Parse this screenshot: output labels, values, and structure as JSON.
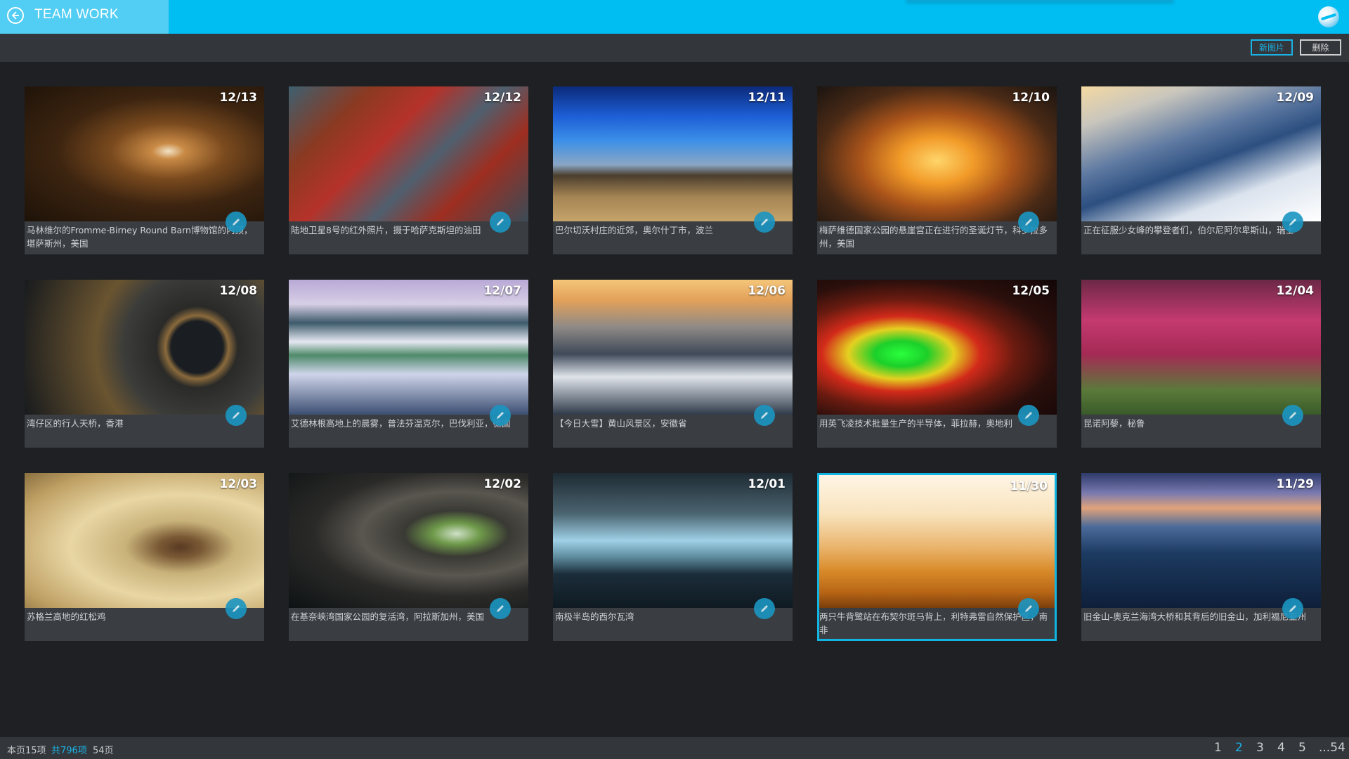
{
  "app": {
    "title": "TEAM WORK",
    "logo_icon": "globe-logo-icon",
    "back_icon": "back-arrow-icon"
  },
  "toolbar": {
    "new_label": "新图片",
    "delete_label": "删除"
  },
  "gallery": [
    {
      "date": "12/13",
      "caption": "马林维尔的Fromme-Birney Round Barn博物馆的内顶，堪萨斯州，美国",
      "selected": false
    },
    {
      "date": "12/12",
      "caption": "陆地卫星8号的红外照片，摄于哈萨克斯坦的油田",
      "selected": false
    },
    {
      "date": "12/11",
      "caption": "巴尔切沃村庄的近郊，奥尔什丁市，波兰",
      "selected": false
    },
    {
      "date": "12/10",
      "caption": "梅萨维德国家公园的悬崖宫正在进行的圣诞灯节，科罗拉多州，美国",
      "selected": false
    },
    {
      "date": "12/09",
      "caption": "正在征服少女峰的攀登者们，伯尔尼阿尔卑斯山，瑞士",
      "selected": false
    },
    {
      "date": "12/08",
      "caption": "湾仔区的行人天桥，香港",
      "selected": false
    },
    {
      "date": "12/07",
      "caption": "艾德林根高地上的晨雾，普法芬温克尔，巴伐利亚，德国",
      "selected": false
    },
    {
      "date": "12/06",
      "caption": "【今日大雪】黄山风景区，安徽省",
      "selected": false
    },
    {
      "date": "12/05",
      "caption": "用英飞凌技术批量生产的半导体，菲拉赫，奥地利",
      "selected": false
    },
    {
      "date": "12/04",
      "caption": "昆诺阿藜，秘鲁",
      "selected": false
    },
    {
      "date": "12/03",
      "caption": "苏格兰高地的红松鸡",
      "selected": false
    },
    {
      "date": "12/02",
      "caption": "在基奈峡湾国家公园的复活湾，阿拉斯加州，美国",
      "selected": false
    },
    {
      "date": "12/01",
      "caption": "南极半岛的西尔瓦湾",
      "selected": false
    },
    {
      "date": "11/30",
      "caption": "两只牛背鹭站在布契尔斑马背上，利特弗雷自然保护区，南非",
      "selected": true
    },
    {
      "date": "11/29",
      "caption": "旧金山-奥克兰海湾大桥和其背后的旧金山，加利福尼亚州",
      "selected": false
    }
  ],
  "status": {
    "current_page_items": "本页15项",
    "total_items": "共796项",
    "total_pages": "54页"
  },
  "pagination": [
    "1",
    "2",
    "3",
    "4",
    "5",
    "...54"
  ],
  "active_page": "2",
  "colors": {
    "accent": "#00bdf2",
    "background": "#1e2023",
    "card": "#3a3d41",
    "bar": "#33373c"
  }
}
